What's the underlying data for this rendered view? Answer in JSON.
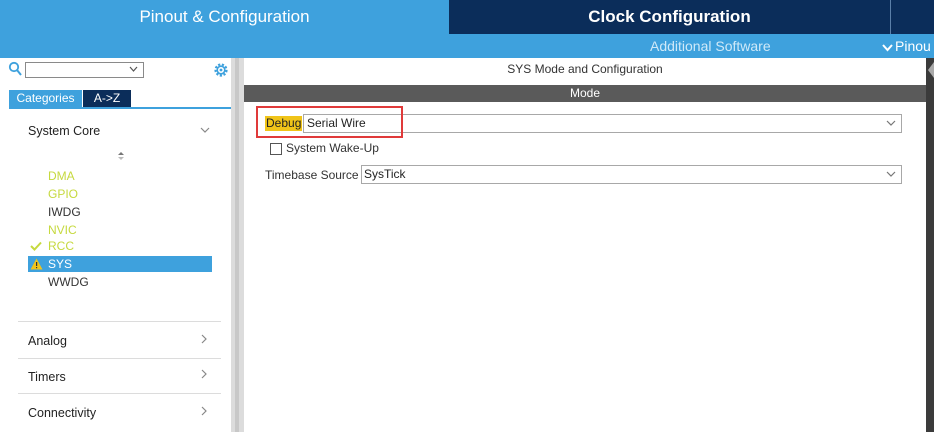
{
  "tabs": {
    "pinout": "Pinout & Configuration",
    "clock": "Clock Configuration"
  },
  "subbar": {
    "additional_software": "Additional Software",
    "pinout_view": "Pinou"
  },
  "left": {
    "categories_tab": "Categories",
    "az_tab": "A->Z",
    "categories": {
      "system_core": "System Core",
      "analog": "Analog",
      "timers": "Timers",
      "connectivity": "Connectivity"
    },
    "peripherals": [
      {
        "label": "DMA",
        "color": "#c6d93e"
      },
      {
        "label": "GPIO",
        "color": "#c6d93e"
      },
      {
        "label": "IWDG",
        "color": "#333333"
      },
      {
        "label": "NVIC",
        "color": "#c6d93e"
      },
      {
        "label": "RCC",
        "color": "#c6d93e"
      },
      {
        "label": "SYS",
        "color": "#ffffff"
      },
      {
        "label": "WWDG",
        "color": "#333333"
      }
    ]
  },
  "right": {
    "title": "SYS Mode and Configuration",
    "mode_header": "Mode",
    "debug_label": "Debug",
    "debug_value": "Serial Wire",
    "wake_label": "System Wake-Up",
    "timebase_label": "Timebase Source",
    "timebase_value": "SysTick"
  },
  "colors": {
    "accent": "#3ea1dd",
    "dark_tab": "#0b2d5a",
    "highlight": "#f0c419",
    "red_box": "#e03a3a"
  }
}
